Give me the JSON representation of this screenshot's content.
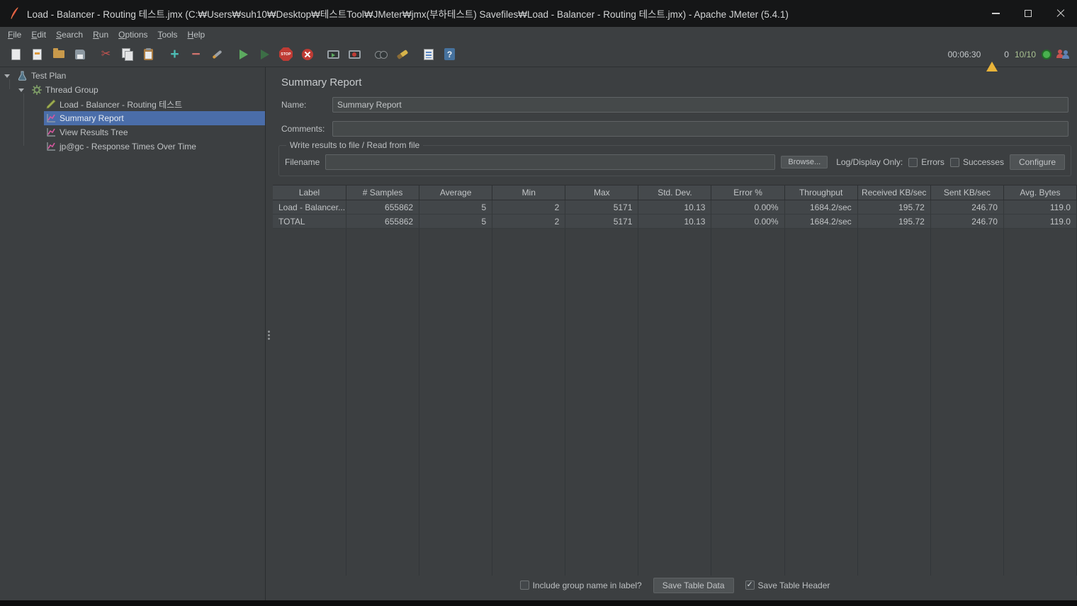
{
  "window": {
    "title": "Load - Balancer - Routing 테스트.jmx (C:₩Users₩suh10₩Desktop₩테스트Tool₩JMeter₩jmx(부하테스트) Savefiles₩Load - Balancer - Routing 테스트.jmx) - Apache JMeter (5.4.1)"
  },
  "menu": {
    "items": [
      "File",
      "Edit",
      "Search",
      "Run",
      "Options",
      "Tools",
      "Help"
    ]
  },
  "toolbar": {
    "icon_names": [
      "new-file-icon",
      "templates-icon",
      "open-file-icon",
      "save-icon",
      "cut-icon",
      "copy-icon",
      "paste-icon",
      "add-element-icon",
      "remove-element-icon",
      "toggle-element-icon",
      "start-icon",
      "start-no-pauses-icon",
      "stop-icon",
      "shutdown-icon",
      "remote-start-all-icon",
      "remote-shutdown-all-icon",
      "search-icon",
      "clear-icon",
      "clear-all-icon",
      "help-icon"
    ],
    "timer": "00:06:30",
    "error_count": "0",
    "threads": "10/10",
    "status_icon_names": [
      "warning-icon",
      "running-indicator-icon",
      "users-icon"
    ]
  },
  "tree": {
    "items": [
      {
        "label": "Test Plan",
        "icon": "test-plan-icon",
        "level": 0,
        "selected": false
      },
      {
        "label": "Thread Group",
        "icon": "thread-group-gear-icon",
        "level": 1,
        "selected": false
      },
      {
        "label": "Load - Balancer - Routing 테스트",
        "icon": "sampler-pencil-icon",
        "level": 2,
        "selected": false
      },
      {
        "label": "Summary Report",
        "icon": "listener-chart-icon",
        "level": 2,
        "selected": true
      },
      {
        "label": "View Results Tree",
        "icon": "listener-chart-icon",
        "level": 2,
        "selected": false
      },
      {
        "label": "jp@gc - Response Times Over Time",
        "icon": "listener-chart-icon",
        "level": 2,
        "selected": false
      }
    ]
  },
  "main": {
    "title": "Summary Report",
    "name": {
      "label": "Name:",
      "value": "Summary Report"
    },
    "comments": {
      "label": "Comments:",
      "value": ""
    },
    "file_section": {
      "title": "Write results to file / Read from file",
      "filename_label": "Filename",
      "filename_value": "",
      "browse_button": "Browse...",
      "log_display_label": "Log/Display Only:",
      "errors_checkbox": {
        "label": "Errors",
        "checked": false
      },
      "successes_checkbox": {
        "label": "Successes",
        "checked": false
      },
      "configure_button": "Configure"
    },
    "table": {
      "columns": [
        "Label",
        "# Samples",
        "Average",
        "Min",
        "Max",
        "Std. Dev.",
        "Error %",
        "Throughput",
        "Received KB/sec",
        "Sent KB/sec",
        "Avg. Bytes"
      ],
      "rows": [
        [
          "Load - Balancer...",
          "655862",
          "5",
          "2",
          "5171",
          "10.13",
          "0.00%",
          "1684.2/sec",
          "195.72",
          "246.70",
          "119.0"
        ],
        [
          "TOTAL",
          "655862",
          "5",
          "2",
          "5171",
          "10.13",
          "0.00%",
          "1684.2/sec",
          "195.72",
          "246.70",
          "119.0"
        ]
      ]
    },
    "footer": {
      "include_group_checkbox": {
        "label": "Include group name in label?",
        "checked": false
      },
      "save_table_button": "Save Table Data",
      "save_header_checkbox": {
        "label": "Save Table Header",
        "checked": true
      }
    }
  },
  "colors": {
    "selection": "#4a6da9",
    "running_green": "#49b14f",
    "warning_yellow": "#e8b339",
    "panel_bg": "#3c3f41",
    "titlebar_bg": "#151617"
  }
}
